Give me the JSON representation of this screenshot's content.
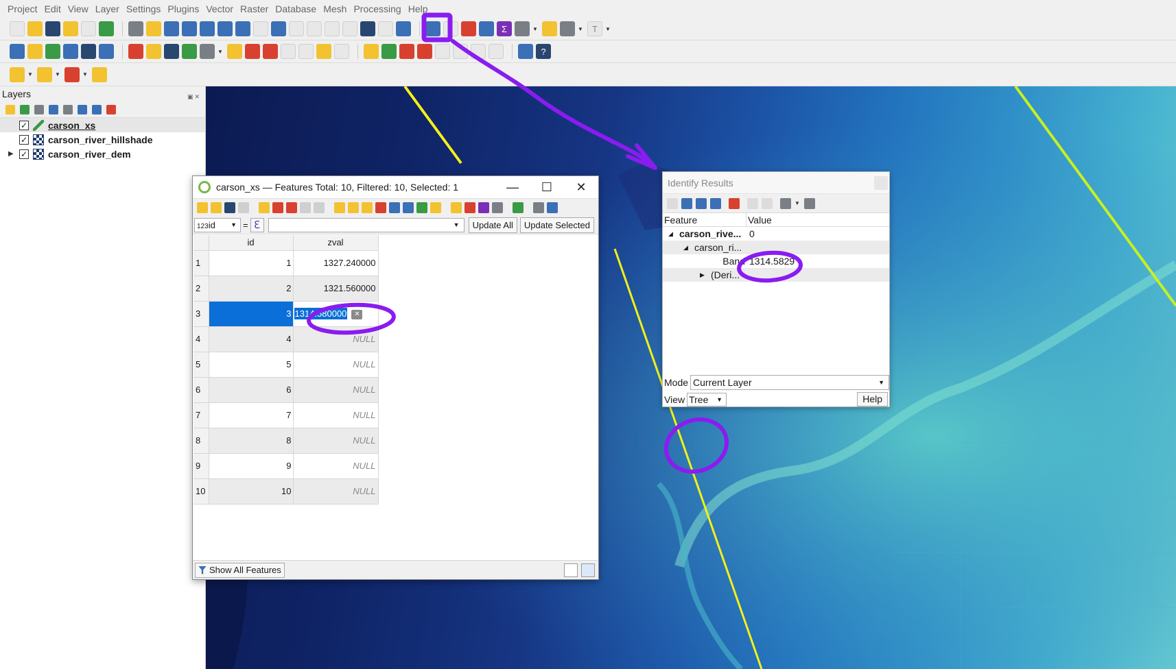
{
  "menu": [
    "Project",
    "Edit",
    "View",
    "Layer",
    "Settings",
    "Plugins",
    "Vector",
    "Raster",
    "Database",
    "Mesh",
    "Processing",
    "Help"
  ],
  "layers_panel": {
    "title": "Layers",
    "layers": [
      {
        "name": "carson_xs",
        "checked": "✓",
        "icon": "line-layer-icon"
      },
      {
        "name": "carson_river_hillshade",
        "checked": "✓",
        "icon": "raster-layer-icon"
      },
      {
        "name": "carson_river_dem",
        "checked": "✓",
        "icon": "raster-layer-icon",
        "expand": "▶"
      }
    ]
  },
  "attribute_table": {
    "title": "carson_xs — Features Total: 10, Filtered: 10, Selected: 1",
    "field_select": "id",
    "field_type_prefix": "123",
    "equals": "=",
    "expression_icon": "ℇ",
    "update_all": "Update All",
    "update_selected": "Update Selected",
    "columns": [
      "id",
      "zval"
    ],
    "rows": [
      {
        "row": "1",
        "id": "1",
        "zval": "1327.240000"
      },
      {
        "row": "2",
        "id": "2",
        "zval": "1321.560000"
      },
      {
        "row": "3",
        "id": "3",
        "zval": "1314.580000"
      },
      {
        "row": "4",
        "id": "4",
        "zval": "NULL"
      },
      {
        "row": "5",
        "id": "5",
        "zval": "NULL"
      },
      {
        "row": "6",
        "id": "6",
        "zval": "NULL"
      },
      {
        "row": "7",
        "id": "7",
        "zval": "NULL"
      },
      {
        "row": "8",
        "id": "8",
        "zval": "NULL"
      },
      {
        "row": "9",
        "id": "9",
        "zval": "NULL"
      },
      {
        "row": "10",
        "id": "10",
        "zval": "NULL"
      }
    ],
    "show_features": "Show All Features",
    "minimize": "—",
    "maximize": "☐",
    "close": "✕"
  },
  "identify_results": {
    "title": "Identify Results",
    "col_feature": "Feature",
    "col_value": "Value",
    "rows": [
      {
        "feature": "carson_rive...",
        "value": "0"
      },
      {
        "feature": "carson_ri...",
        "value": ""
      },
      {
        "feature": "Band",
        "value": "1314.5829"
      },
      {
        "feature": "(Deri...",
        "value": ""
      }
    ],
    "mode_label": "Mode",
    "mode_value": "Current Layer",
    "view_label": "View",
    "view_value": "Tree",
    "help": "Help"
  },
  "colors": {
    "annotation": "#8a1cf0",
    "selection": "#0a6fd8",
    "cross_section_line": "#f5f018"
  }
}
